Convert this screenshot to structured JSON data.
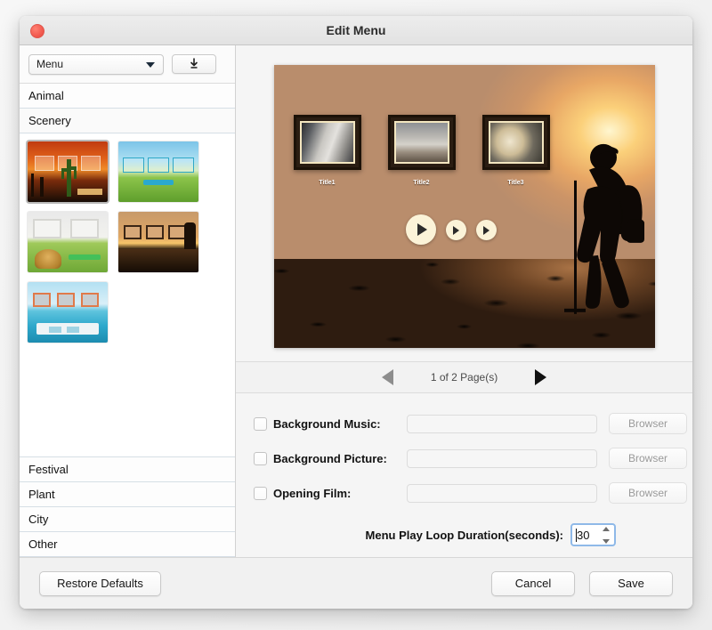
{
  "window": {
    "title": "Edit Menu",
    "close_label": "close"
  },
  "left_panel": {
    "template_dropdown": {
      "value": "Menu",
      "icon": "chevron-down-icon"
    },
    "export_button": {
      "icon": "download-icon"
    },
    "categories_top": [
      {
        "label": "Animal",
        "selected": false
      },
      {
        "label": "Scenery",
        "selected": true
      }
    ],
    "categories_bottom": [
      {
        "label": "Festival",
        "selected": false
      },
      {
        "label": "Plant",
        "selected": false
      },
      {
        "label": "City",
        "selected": false
      },
      {
        "label": "Other",
        "selected": false
      }
    ],
    "thumbnails": [
      {
        "name": "cactus-sunset-template",
        "selected": true
      },
      {
        "name": "green-field-sky-template",
        "selected": false
      },
      {
        "name": "hay-bale-field-template",
        "selected": false
      },
      {
        "name": "photographer-sunset-template",
        "selected": false
      },
      {
        "name": "beach-sea-template",
        "selected": false
      }
    ]
  },
  "preview": {
    "titles": [
      "Title1",
      "Title2",
      "Title3"
    ],
    "play_button": "play-button",
    "next_buttons": [
      "play-small-button-1",
      "play-small-button-2"
    ]
  },
  "pager": {
    "text": "1 of 2 Page(s)",
    "prev_icon": "arrow-left-icon",
    "next_icon": "arrow-right-icon",
    "prev_enabled": false,
    "next_enabled": true
  },
  "options": [
    {
      "label": "Background Music:",
      "checked": false,
      "value": "",
      "placeholder": "",
      "button": "Browser",
      "button_enabled": false
    },
    {
      "label": "Background Picture:",
      "checked": false,
      "value": "",
      "placeholder": "",
      "button": "Browser",
      "button_enabled": false
    },
    {
      "label": "Opening Film:",
      "checked": false,
      "value": "",
      "placeholder": "",
      "button": "Browser",
      "button_enabled": false
    }
  ],
  "duration": {
    "label": "Menu Play Loop Duration(seconds):",
    "value": "30"
  },
  "footer": {
    "restore": "Restore Defaults",
    "cancel": "Cancel",
    "save": "Save"
  },
  "colors": {
    "accent_focus": "#8fb9e8",
    "close_red": "#f25b50",
    "panel_bg": "#f5f5f5",
    "window_bg": "#ffffff"
  }
}
